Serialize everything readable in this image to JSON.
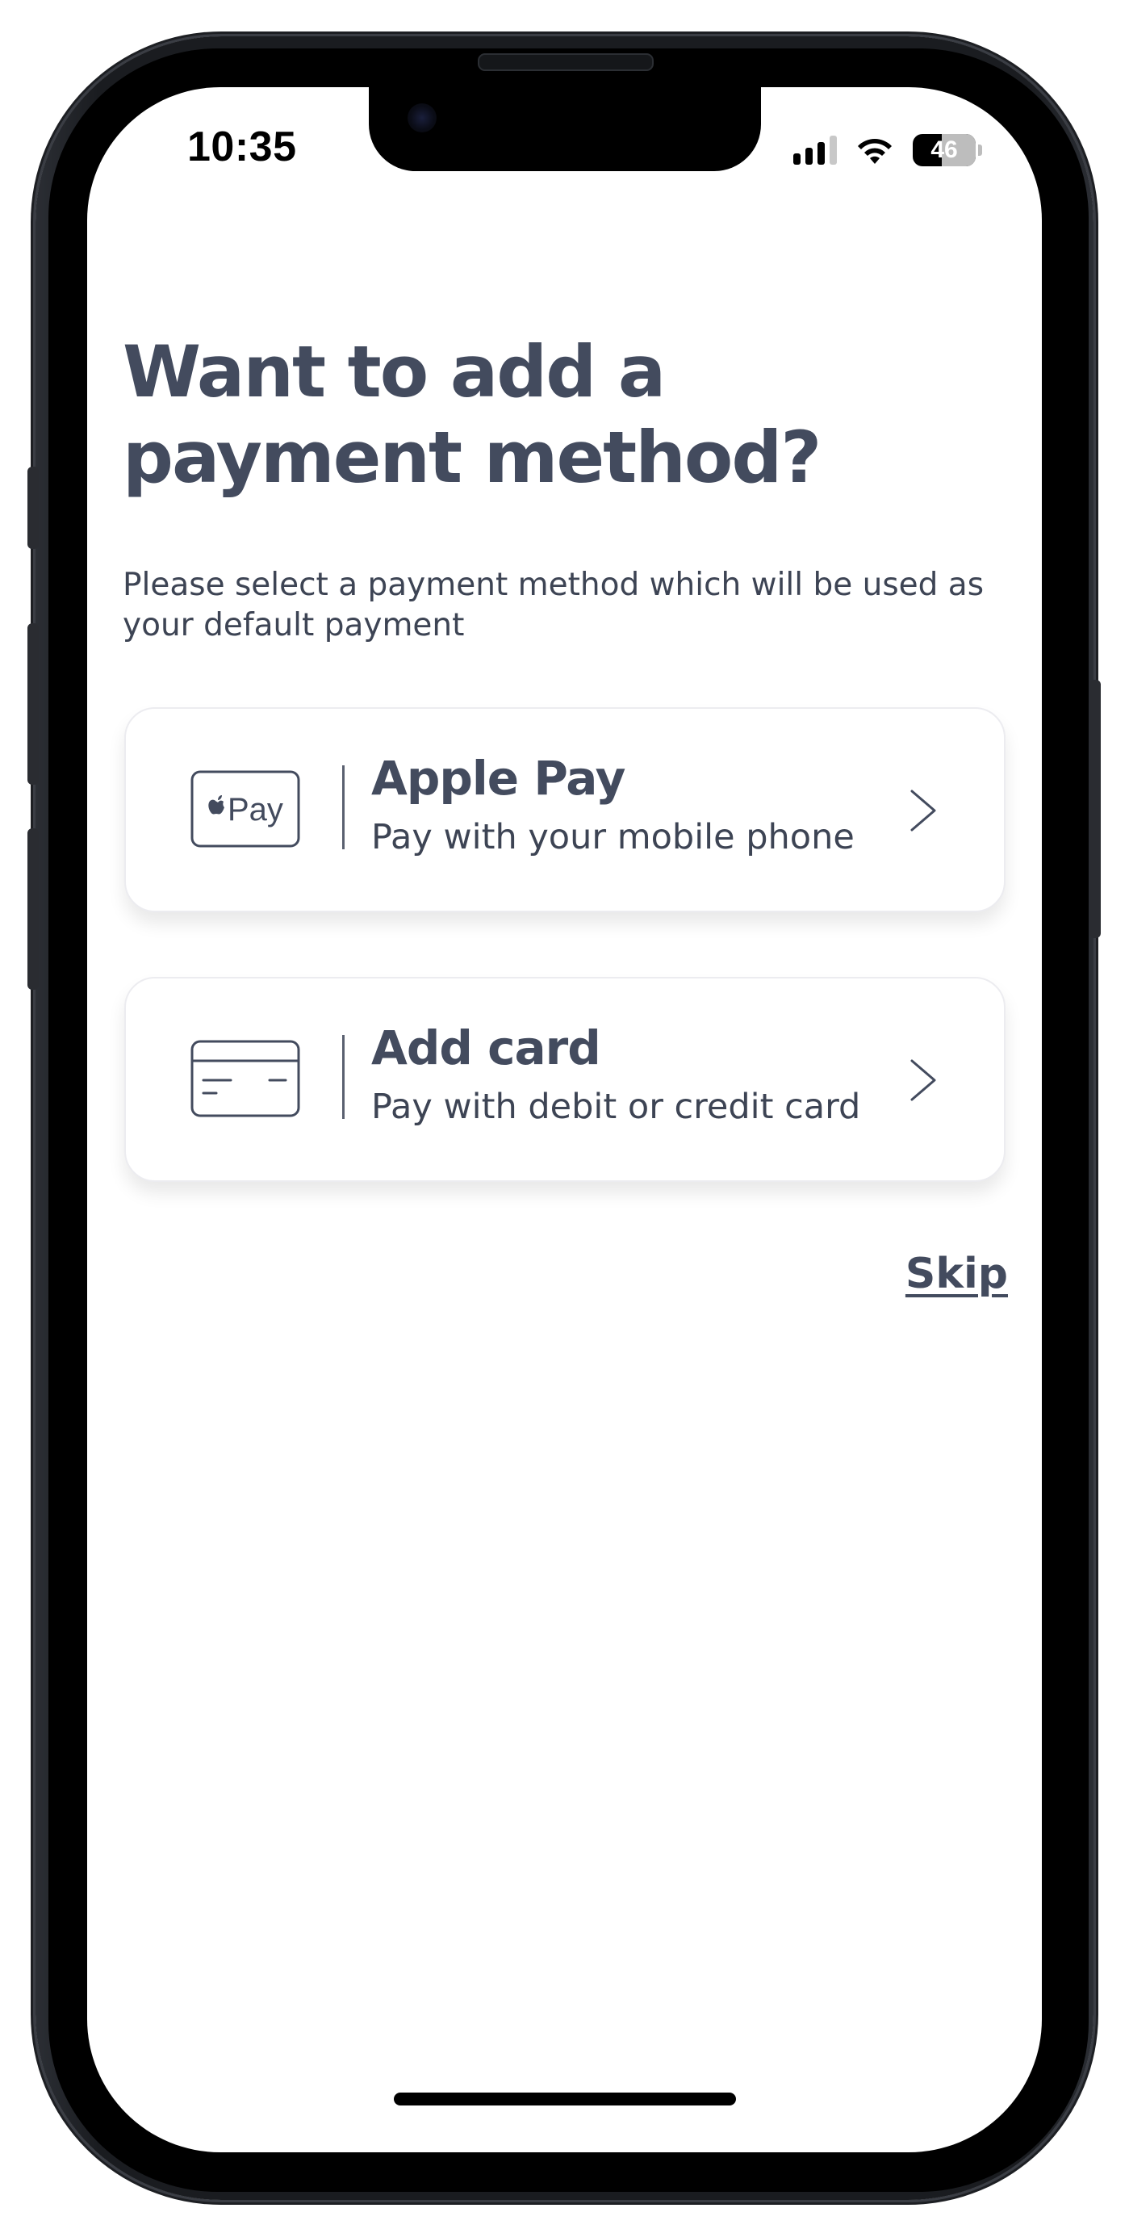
{
  "status_bar": {
    "time": "10:35",
    "battery_level": "46",
    "battery_fraction": 0.46
  },
  "page": {
    "heading_line1": "Want to add a",
    "heading_line2": "payment method?",
    "subtitle": "Please select a payment method which will be used as your default payment"
  },
  "options": [
    {
      "title": "Apple Pay",
      "description": "Pay with your mobile phone",
      "icon": "apple-pay-icon"
    },
    {
      "title": "Add card",
      "description": "Pay with debit or credit card",
      "icon": "credit-card-icon"
    }
  ],
  "apple_pay_logo_text": "Pay",
  "skip_label": "Skip",
  "colors": {
    "text_primary": "#434b5e",
    "text_secondary": "#3d4454",
    "card_border": "#ececf0",
    "background": "#ffffff"
  }
}
